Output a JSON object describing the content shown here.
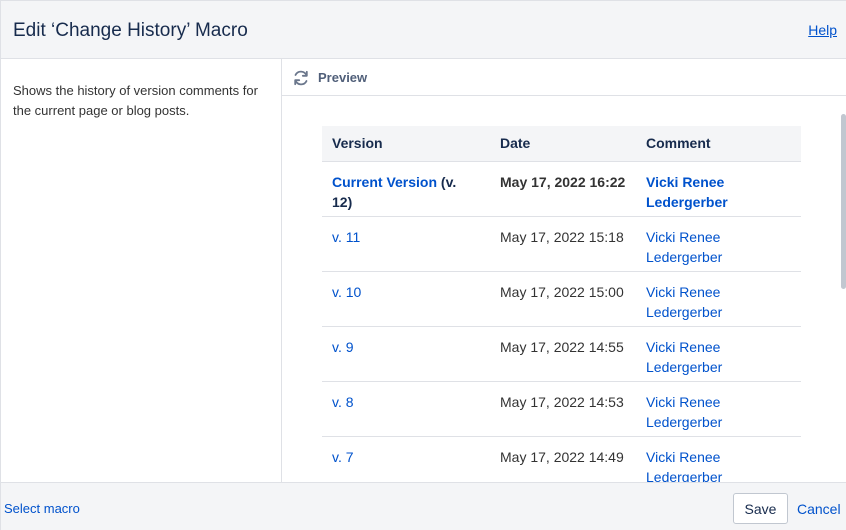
{
  "header": {
    "title": "Edit ‘Change History’ Macro",
    "help_label": "Help"
  },
  "sidebar": {
    "description": "Shows the history of version comments for the current page or blog posts."
  },
  "preview": {
    "label": "Preview",
    "icon": "refresh-icon",
    "table": {
      "columns": [
        "Version",
        "Date",
        "Comment"
      ],
      "rows": [
        {
          "version_link": "Current Version",
          "version_suffix": " (v. 12)",
          "date": "May 17, 2022 16:22",
          "comment": "Vicki Renee Ledergerber",
          "current": true
        },
        {
          "version_link": "v. 11",
          "version_suffix": "",
          "date": "May 17, 2022 15:18",
          "comment": "Vicki Renee Ledergerber",
          "current": false
        },
        {
          "version_link": "v. 10",
          "version_suffix": "",
          "date": "May 17, 2022 15:00",
          "comment": "Vicki Renee Ledergerber",
          "current": false
        },
        {
          "version_link": "v. 9",
          "version_suffix": "",
          "date": "May 17, 2022 14:55",
          "comment": "Vicki Renee Ledergerber",
          "current": false
        },
        {
          "version_link": "v. 8",
          "version_suffix": "",
          "date": "May 17, 2022 14:53",
          "comment": "Vicki Renee Ledergerber",
          "current": false
        },
        {
          "version_link": "v. 7",
          "version_suffix": "",
          "date": "May 17, 2022 14:49",
          "comment": "Vicki Renee Ledergerber",
          "current": false
        }
      ]
    }
  },
  "footer": {
    "select_macro_label": "Select macro",
    "save_label": "Save",
    "cancel_label": "Cancel"
  },
  "colors": {
    "link": "#0052cc",
    "header_bg": "#f4f5f7",
    "border": "#dfe1e6"
  }
}
